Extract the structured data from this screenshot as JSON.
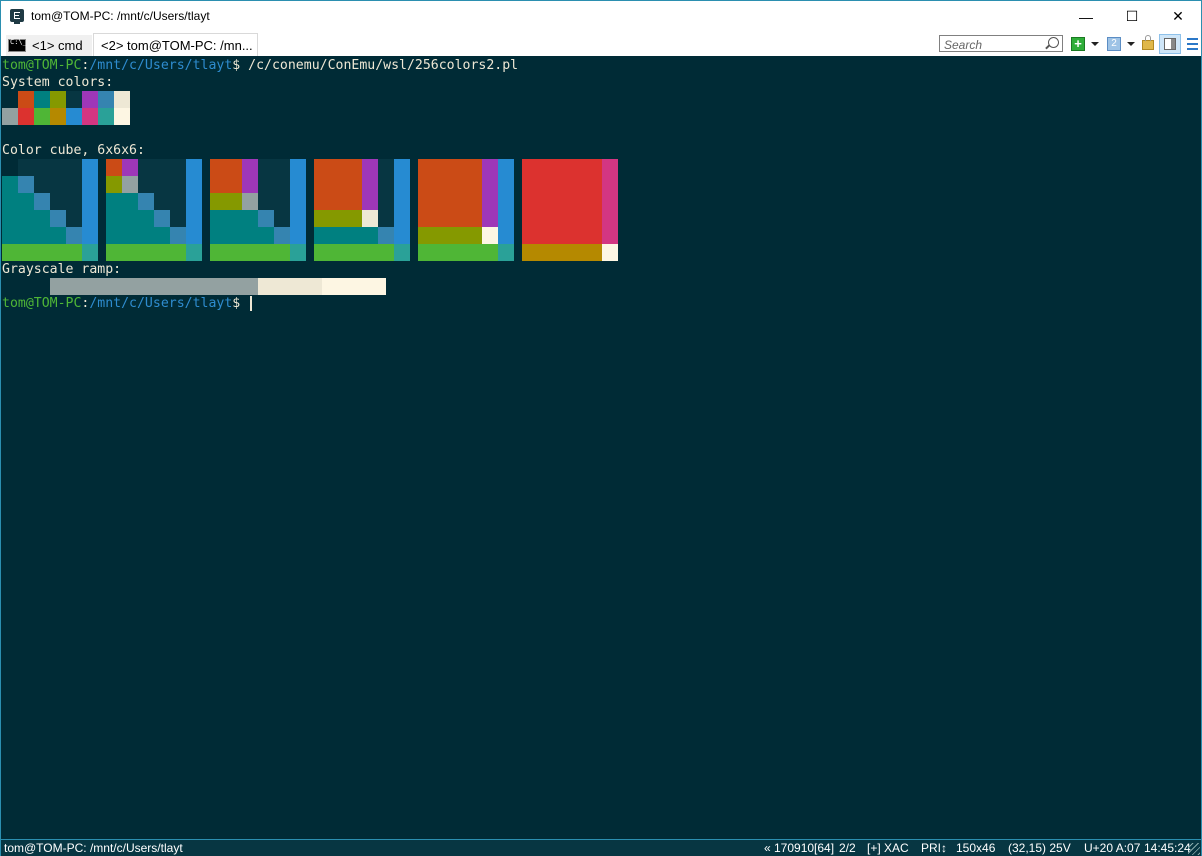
{
  "window": {
    "title": "tom@TOM-PC: /mnt/c/Users/tlayt",
    "controls": {
      "minimize": "—",
      "maximize": "☐",
      "close": "✕"
    }
  },
  "tabs": [
    {
      "label": "<1> cmd",
      "icon": "cmd-icon",
      "active": false
    },
    {
      "label": "<2> tom@TOM-PC: /mn...",
      "active": true
    }
  ],
  "toolbar": {
    "search_placeholder": "Search",
    "new_console": "+",
    "console_number": "2"
  },
  "terminal": {
    "prompt_user": "tom@TOM-PC",
    "prompt_sep": ":",
    "prompt_path": "/mnt/c/Users/tlayt",
    "prompt_dollar": "$",
    "command": " /c/conemu/ConEmu/wsl/256colors2.pl",
    "system_colors_label": "System colors:",
    "color_cube_label": "Color cube, 6x6x6:",
    "grayscale_label": "Grayscale ramp:",
    "palette": [
      "#073642",
      "#cb4b16",
      "#008080",
      "#859900",
      "#073642",
      "#9e37b8",
      "#3584b0",
      "#eee8d5",
      "#93a1a1",
      "#dc322f",
      "#4fb636",
      "#b58900",
      "#268bd2",
      "#d33682",
      "#2aa198",
      "#fdf6e3"
    ],
    "system_colors_rows": [
      [
        "#002b36",
        "#cb4b16",
        "#008080",
        "#859900",
        "#073642",
        "#9e37b8",
        "#3584b0",
        "#eee8d5"
      ],
      [
        "#93a1a1",
        "#dc322f",
        "#4fb636",
        "#b58900",
        "#268bd2",
        "#d33682",
        "#2aa198",
        "#fdf6e3"
      ]
    ],
    "color_cubes": [
      [
        [
          "#002b36",
          "#073642",
          "#073642",
          "#073642",
          "#073642",
          "#268bd2"
        ],
        [
          "#008080",
          "#3584b0",
          "#073642",
          "#073642",
          "#073642",
          "#268bd2"
        ],
        [
          "#008080",
          "#008080",
          "#3584b0",
          "#073642",
          "#073642",
          "#268bd2"
        ],
        [
          "#008080",
          "#008080",
          "#008080",
          "#3584b0",
          "#073642",
          "#268bd2"
        ],
        [
          "#008080",
          "#008080",
          "#008080",
          "#008080",
          "#3584b0",
          "#268bd2"
        ],
        [
          "#4fb636",
          "#4fb636",
          "#4fb636",
          "#4fb636",
          "#4fb636",
          "#2aa198"
        ]
      ],
      [
        [
          "#cb4b16",
          "#9e37b8",
          "#073642",
          "#073642",
          "#073642",
          "#268bd2"
        ],
        [
          "#859900",
          "#93a1a1",
          "#073642",
          "#073642",
          "#073642",
          "#268bd2"
        ],
        [
          "#008080",
          "#008080",
          "#3584b0",
          "#073642",
          "#073642",
          "#268bd2"
        ],
        [
          "#008080",
          "#008080",
          "#008080",
          "#3584b0",
          "#073642",
          "#268bd2"
        ],
        [
          "#008080",
          "#008080",
          "#008080",
          "#008080",
          "#3584b0",
          "#268bd2"
        ],
        [
          "#4fb636",
          "#4fb636",
          "#4fb636",
          "#4fb636",
          "#4fb636",
          "#2aa198"
        ]
      ],
      [
        [
          "#cb4b16",
          "#cb4b16",
          "#9e37b8",
          "#073642",
          "#073642",
          "#268bd2"
        ],
        [
          "#cb4b16",
          "#cb4b16",
          "#9e37b8",
          "#073642",
          "#073642",
          "#268bd2"
        ],
        [
          "#859900",
          "#859900",
          "#93a1a1",
          "#073642",
          "#073642",
          "#268bd2"
        ],
        [
          "#008080",
          "#008080",
          "#008080",
          "#3584b0",
          "#073642",
          "#268bd2"
        ],
        [
          "#008080",
          "#008080",
          "#008080",
          "#008080",
          "#3584b0",
          "#268bd2"
        ],
        [
          "#4fb636",
          "#4fb636",
          "#4fb636",
          "#4fb636",
          "#4fb636",
          "#2aa198"
        ]
      ],
      [
        [
          "#cb4b16",
          "#cb4b16",
          "#cb4b16",
          "#9e37b8",
          "#073642",
          "#268bd2"
        ],
        [
          "#cb4b16",
          "#cb4b16",
          "#cb4b16",
          "#9e37b8",
          "#073642",
          "#268bd2"
        ],
        [
          "#cb4b16",
          "#cb4b16",
          "#cb4b16",
          "#9e37b8",
          "#073642",
          "#268bd2"
        ],
        [
          "#859900",
          "#859900",
          "#859900",
          "#eee8d5",
          "#073642",
          "#268bd2"
        ],
        [
          "#008080",
          "#008080",
          "#008080",
          "#008080",
          "#3584b0",
          "#268bd2"
        ],
        [
          "#4fb636",
          "#4fb636",
          "#4fb636",
          "#4fb636",
          "#4fb636",
          "#2aa198"
        ]
      ],
      [
        [
          "#cb4b16",
          "#cb4b16",
          "#cb4b16",
          "#cb4b16",
          "#9e37b8",
          "#268bd2"
        ],
        [
          "#cb4b16",
          "#cb4b16",
          "#cb4b16",
          "#cb4b16",
          "#9e37b8",
          "#268bd2"
        ],
        [
          "#cb4b16",
          "#cb4b16",
          "#cb4b16",
          "#cb4b16",
          "#9e37b8",
          "#268bd2"
        ],
        [
          "#cb4b16",
          "#cb4b16",
          "#cb4b16",
          "#cb4b16",
          "#9e37b8",
          "#268bd2"
        ],
        [
          "#859900",
          "#859900",
          "#859900",
          "#859900",
          "#fdf6e3",
          "#268bd2"
        ],
        [
          "#4fb636",
          "#4fb636",
          "#4fb636",
          "#4fb636",
          "#4fb636",
          "#2aa198"
        ]
      ],
      [
        [
          "#dc322f",
          "#dc322f",
          "#dc322f",
          "#dc322f",
          "#dc322f",
          "#d33682"
        ],
        [
          "#dc322f",
          "#dc322f",
          "#dc322f",
          "#dc322f",
          "#dc322f",
          "#d33682"
        ],
        [
          "#dc322f",
          "#dc322f",
          "#dc322f",
          "#dc322f",
          "#dc322f",
          "#d33682"
        ],
        [
          "#dc322f",
          "#dc322f",
          "#dc322f",
          "#dc322f",
          "#dc322f",
          "#d33682"
        ],
        [
          "#dc322f",
          "#dc322f",
          "#dc322f",
          "#dc322f",
          "#dc322f",
          "#d33682"
        ],
        [
          "#b58900",
          "#b58900",
          "#b58900",
          "#b58900",
          "#b58900",
          "#fdf6e3"
        ]
      ]
    ],
    "grayscale_ramp": [
      "#002b36",
      "#002b36",
      "#002b36",
      "#93a1a1",
      "#93a1a1",
      "#93a1a1",
      "#93a1a1",
      "#93a1a1",
      "#93a1a1",
      "#93a1a1",
      "#93a1a1",
      "#93a1a1",
      "#93a1a1",
      "#93a1a1",
      "#93a1a1",
      "#93a1a1",
      "#eee8d5",
      "#eee8d5",
      "#eee8d5",
      "#eee8d5",
      "#fdf6e3",
      "#fdf6e3",
      "#fdf6e3",
      "#fdf6e3"
    ]
  },
  "status_bar": {
    "title": "tom@TOM-PC: /mnt/c/Users/tlayt",
    "items": [
      "« 170910[64]",
      "2/2",
      "[+] XAC",
      "PRI↕",
      "150x46",
      "(32,15) 25V",
      "U+20 A:07",
      "14:45:24"
    ]
  }
}
